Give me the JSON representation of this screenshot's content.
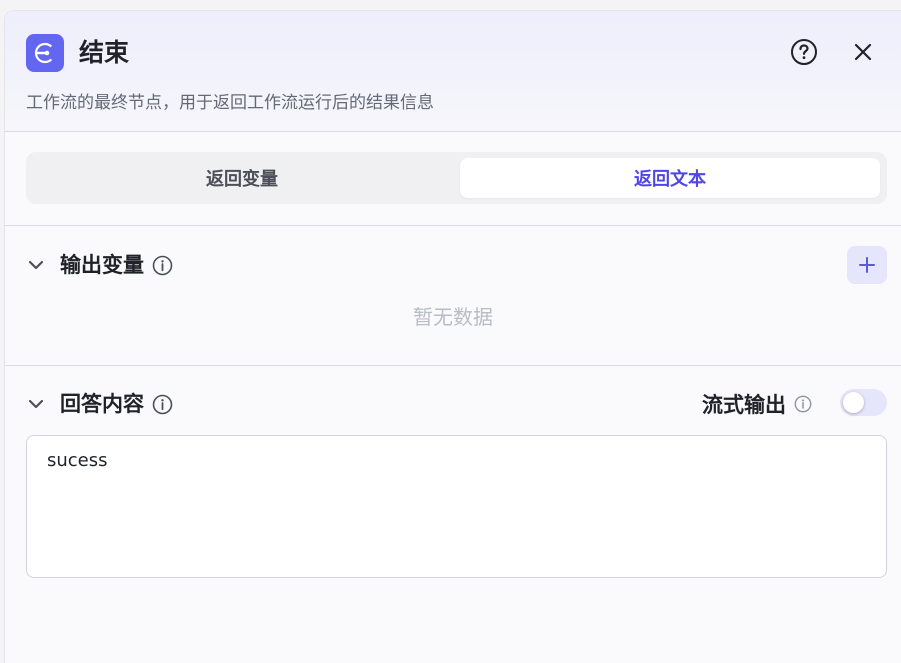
{
  "node": {
    "title": "结束",
    "description": "工作流的最终节点，用于返回工作流运行后的结果信息",
    "icon": "end-node-icon",
    "accent_color": "#6366f1"
  },
  "header_icons": {
    "help": "help-circle-icon",
    "close": "close-icon"
  },
  "tabs": [
    {
      "label": "返回变量",
      "active": false
    },
    {
      "label": "返回文本",
      "active": true
    }
  ],
  "output_section": {
    "label": "输出变量",
    "empty_text": "暂无数据",
    "add_icon": "plus-icon"
  },
  "answer_section": {
    "label": "回答内容",
    "stream_label": "流式输出",
    "stream_enabled": false,
    "content": "sucess"
  }
}
